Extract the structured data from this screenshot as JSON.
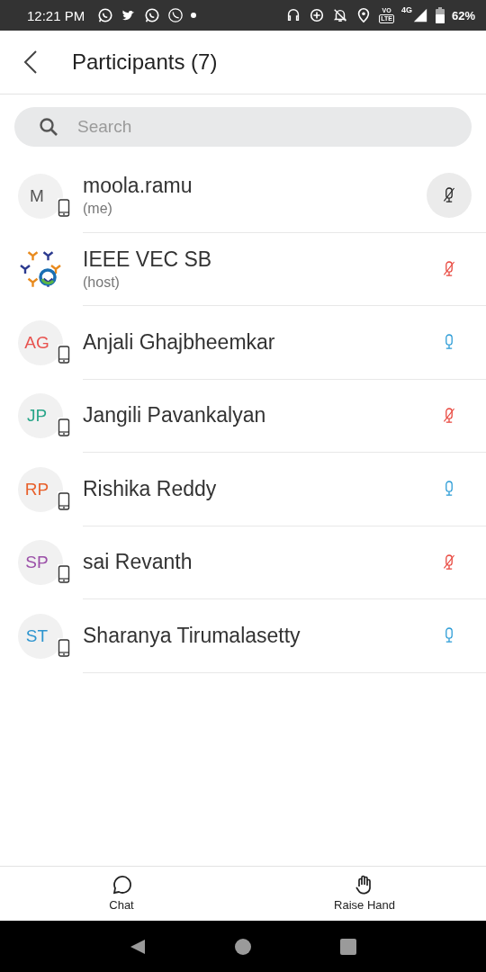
{
  "status_bar": {
    "time": "12:21 PM",
    "volte": [
      "VO",
      "LTE"
    ],
    "network": "4G",
    "battery": "62%"
  },
  "header": {
    "title": "Participants (7)"
  },
  "search": {
    "placeholder": "Search"
  },
  "participants": [
    {
      "kind": "initials",
      "initials": "M",
      "color": "#555555",
      "name": "moola.ramu",
      "role": "(me)",
      "muted": true,
      "mic_highlighted": true
    },
    {
      "kind": "logo",
      "name": "IEEE VEC SB",
      "role": "(host)",
      "muted": true,
      "mic_highlighted": false
    },
    {
      "kind": "initials",
      "initials": "AG",
      "color": "#e8534f",
      "name": "Anjali Ghajbheemkar",
      "muted": false,
      "mic_highlighted": false
    },
    {
      "kind": "initials",
      "initials": "JP",
      "color": "#2aa68a",
      "name": "Jangili Pavankalyan",
      "muted": true,
      "mic_highlighted": false
    },
    {
      "kind": "initials",
      "initials": "RP",
      "color": "#e8612c",
      "name": "Rishika Reddy",
      "muted": false,
      "mic_highlighted": false
    },
    {
      "kind": "initials",
      "initials": "SP",
      "color": "#9b4fa8",
      "name": "sai Revanth",
      "muted": true,
      "mic_highlighted": false
    },
    {
      "kind": "initials",
      "initials": "ST",
      "color": "#2e95cf",
      "name": "Sharanya Tirumalasetty",
      "muted": false,
      "mic_highlighted": false
    }
  ],
  "toolbar": [
    {
      "kind": "chat",
      "label": "Chat"
    },
    {
      "kind": "hand",
      "label": "Raise Hand"
    }
  ]
}
